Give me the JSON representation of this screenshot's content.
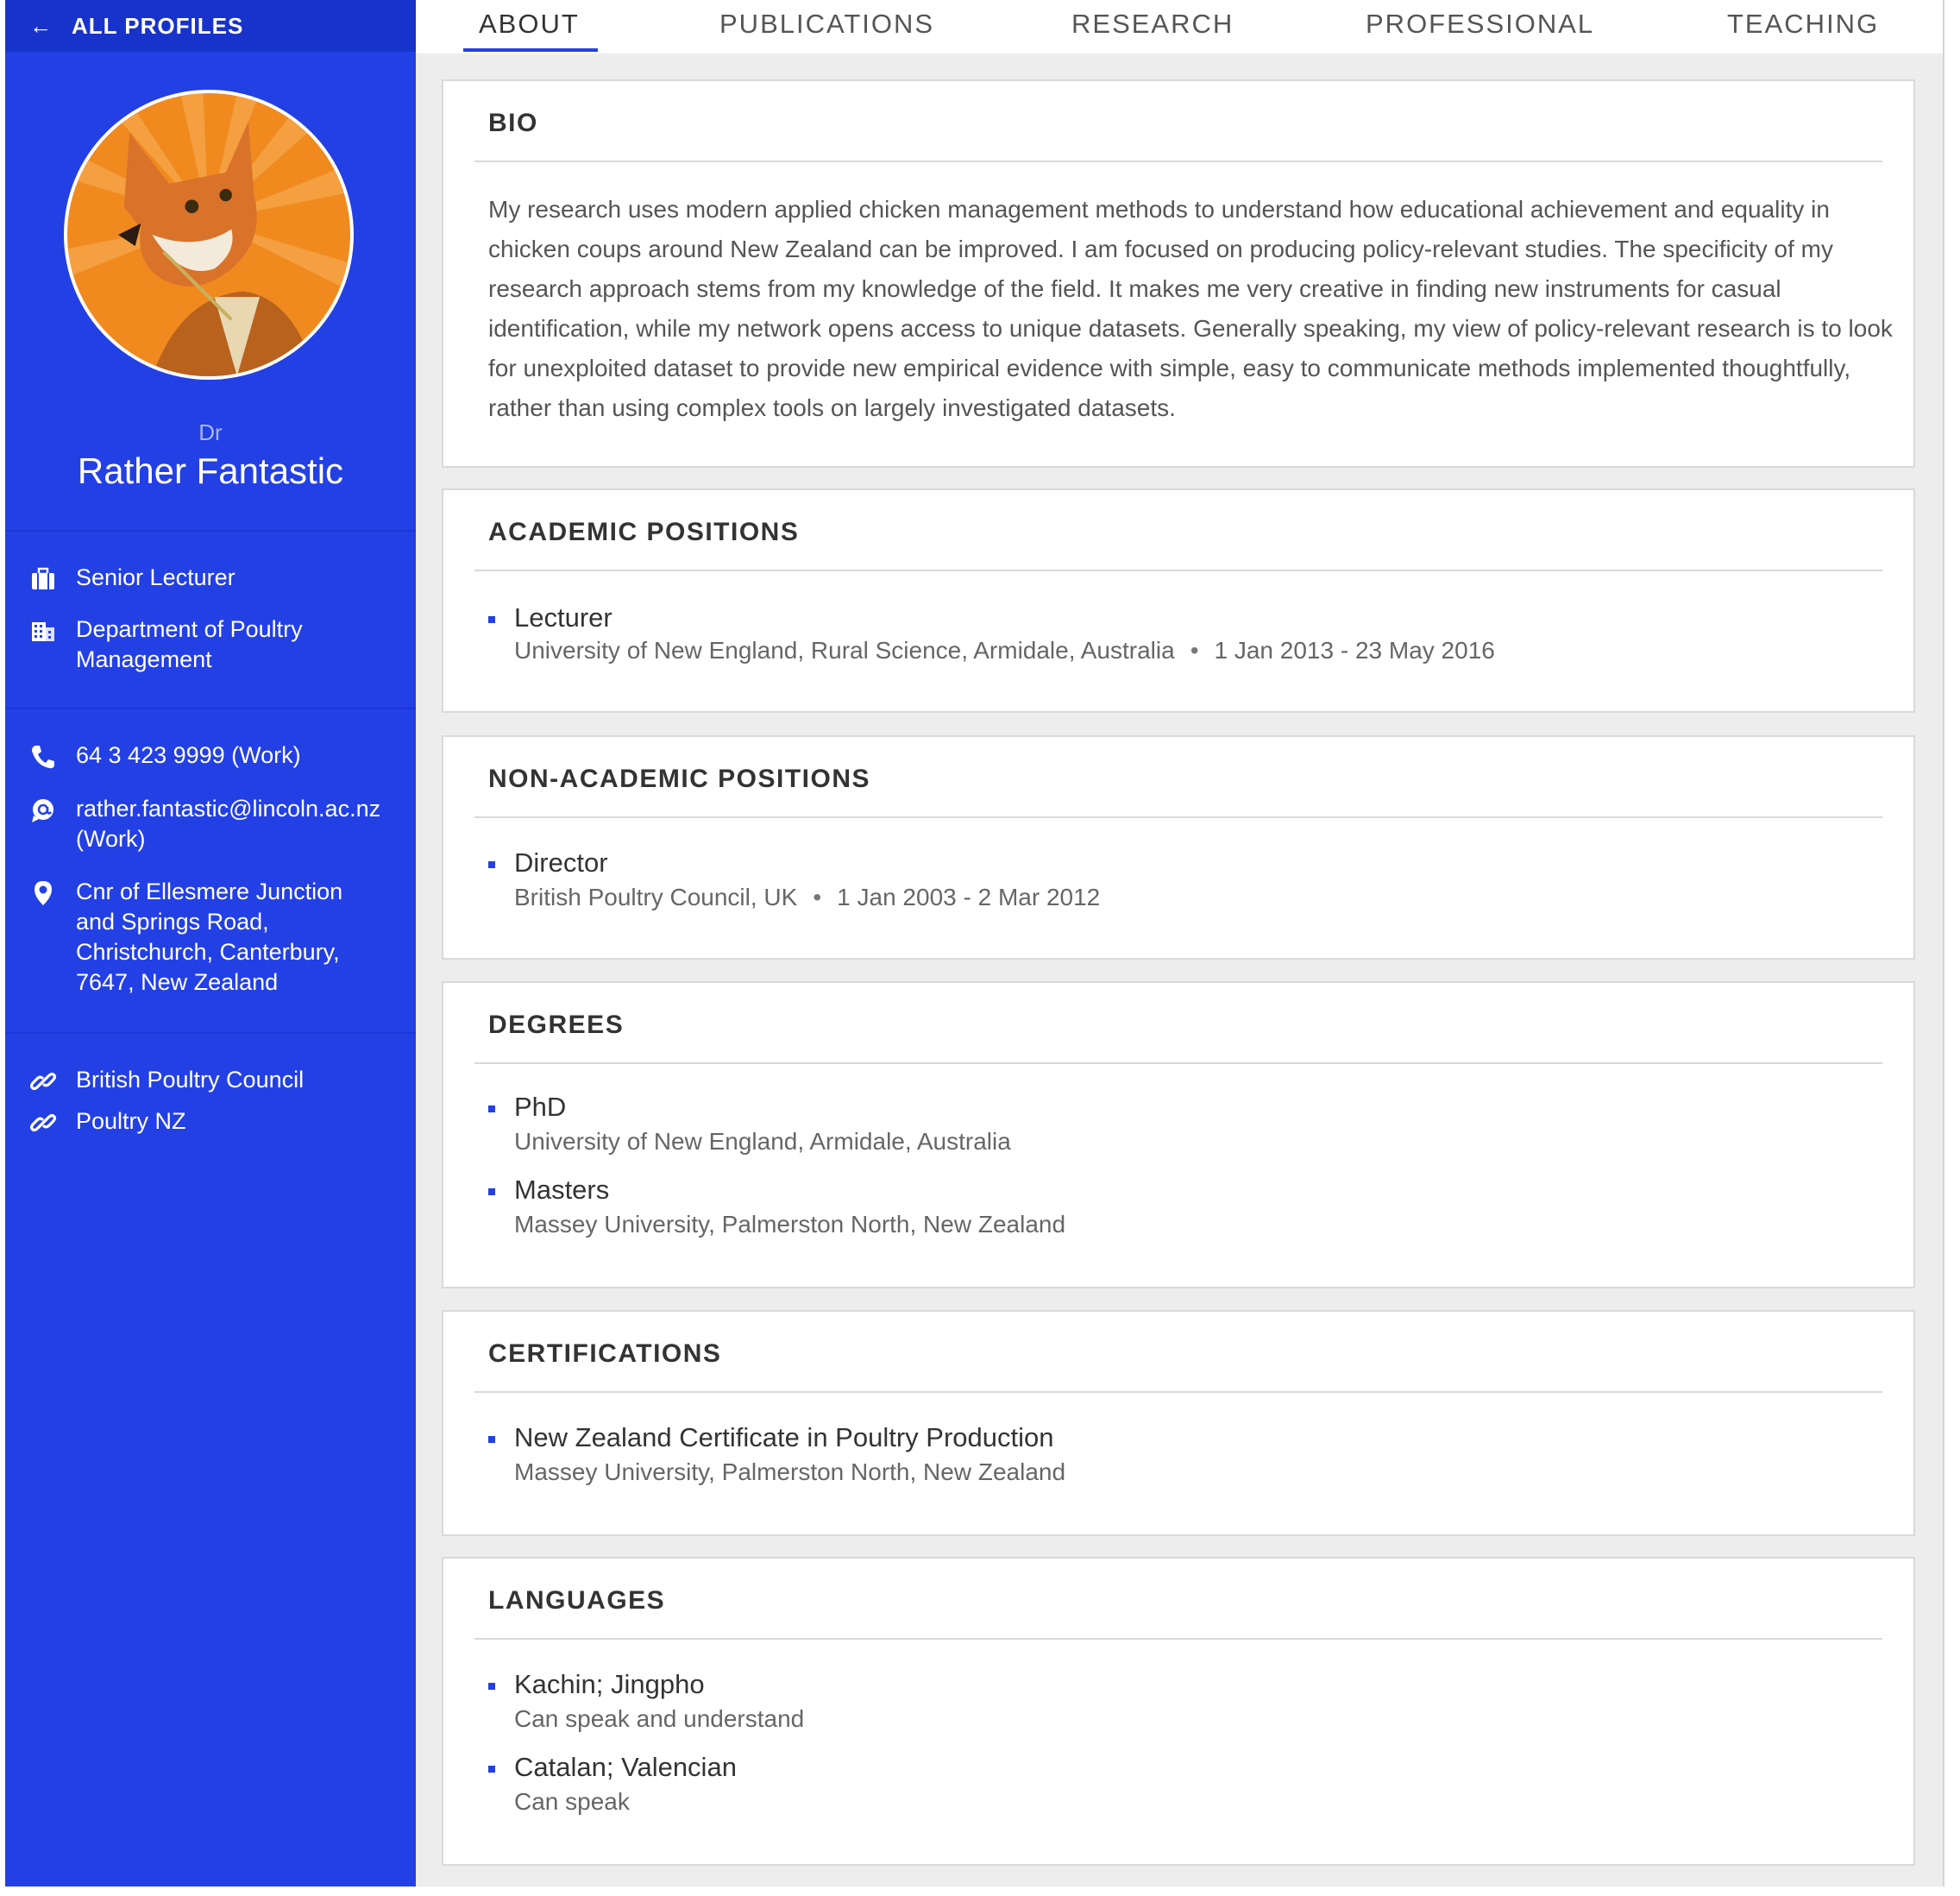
{
  "sidebar": {
    "back_label": "ALL PROFILES",
    "title_prefix": "Dr",
    "name": "Rather Fantastic",
    "position": "Senior Lecturer",
    "department": "Department of Poultry Management",
    "phone": "64 3 423 9999 (Work)",
    "email": "rather.fantastic@lincoln.ac.nz (Work)",
    "address": "Cnr of Ellesmere Junction and Springs Road, Christchurch, Canterbury, 7647, New Zealand",
    "links": [
      "British Poultry Council",
      "Poultry NZ"
    ]
  },
  "tabs": [
    {
      "label": "ABOUT",
      "active": true
    },
    {
      "label": "PUBLICATIONS"
    },
    {
      "label": "RESEARCH"
    },
    {
      "label": "PROFESSIONAL"
    },
    {
      "label": "TEACHING"
    }
  ],
  "bio": {
    "heading": "BIO",
    "text": "My research uses modern applied chicken management methods to understand how educational achievement and equality in chicken coups around New Zealand can be improved. I am focused on producing policy-relevant studies. The specificity of my research approach stems from my knowledge of the field. It makes me very creative in finding new instruments for casual identification, while my network opens access to unique datasets. Generally speaking, my view of policy-relevant research is to look for unexploited dataset to provide new empirical evidence with simple, easy to communicate methods implemented thoughtfully, rather than using complex tools on largely investigated datasets."
  },
  "academic": {
    "heading": "ACADEMIC POSITIONS",
    "items": [
      {
        "title": "Lecturer",
        "org": "University of New England, Rural Science, Armidale, Australia",
        "dates": "1 Jan 2013 - 23 May 2016"
      }
    ]
  },
  "nonacademic": {
    "heading": "NON-ACADEMIC POSITIONS",
    "items": [
      {
        "title": "Director",
        "org": "British Poultry Council, UK",
        "dates": "1 Jan 2003 - 2 Mar 2012"
      }
    ]
  },
  "degrees": {
    "heading": "DEGREES",
    "items": [
      {
        "title": "PhD",
        "org": "University of New England, Armidale, Australia"
      },
      {
        "title": "Masters",
        "org": "Massey University, Palmerston North, New Zealand"
      }
    ]
  },
  "certifications": {
    "heading": "CERTIFICATIONS",
    "items": [
      {
        "title": "New Zealand Certificate in Poultry Production",
        "org": "Massey University, Palmerston North, New Zealand"
      }
    ]
  },
  "languages": {
    "heading": "LANGUAGES",
    "items": [
      {
        "title": "Kachin; Jingpho",
        "level": "Can speak and understand"
      },
      {
        "title": "Catalan; Valencian",
        "level": "Can speak"
      }
    ]
  },
  "colors": {
    "sidebar_bg": "#2340e5",
    "back_bar_bg": "#1833c9",
    "accent": "#2340e5",
    "main_bg": "#ededed"
  }
}
